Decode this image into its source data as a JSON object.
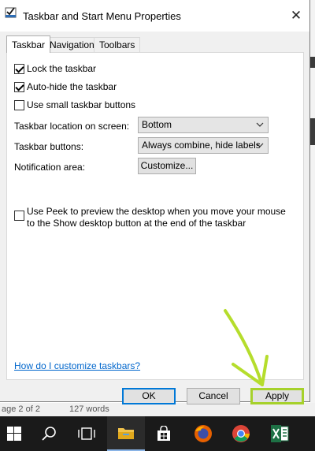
{
  "window": {
    "title": "Taskbar and Start Menu Properties",
    "close_glyph": "✕"
  },
  "tabs": [
    {
      "label": "Taskbar",
      "active": true
    },
    {
      "label": "Navigation",
      "active": false
    },
    {
      "label": "Toolbars",
      "active": false
    }
  ],
  "checkboxes": {
    "lock": {
      "label": "Lock the taskbar",
      "checked": true
    },
    "autohide": {
      "label": "Auto-hide the taskbar",
      "checked": true
    },
    "small": {
      "label": "Use small taskbar buttons",
      "checked": false
    },
    "peek": {
      "label": "Use Peek to preview the desktop when you move your mouse to the Show desktop button at the end of the taskbar",
      "checked": false
    }
  },
  "fields": {
    "location_label": "Taskbar location on screen:",
    "location_value": "Bottom",
    "buttons_label": "Taskbar buttons:",
    "buttons_value": "Always combine, hide labels",
    "notification_label": "Notification area:",
    "customize_label": "Customize..."
  },
  "help_link": "How do I customize taskbars?",
  "footer": {
    "ok": "OK",
    "cancel": "Cancel",
    "apply": "Apply"
  },
  "background_status": {
    "page": "age 2 of 2",
    "words": "127 words"
  },
  "annotation": {
    "color": "#a6d12b"
  },
  "taskbar_icons": [
    "windows-start-icon",
    "search-icon",
    "task-view-icon",
    "file-explorer-icon",
    "store-icon",
    "firefox-icon",
    "chrome-icon",
    "excel-icon"
  ]
}
